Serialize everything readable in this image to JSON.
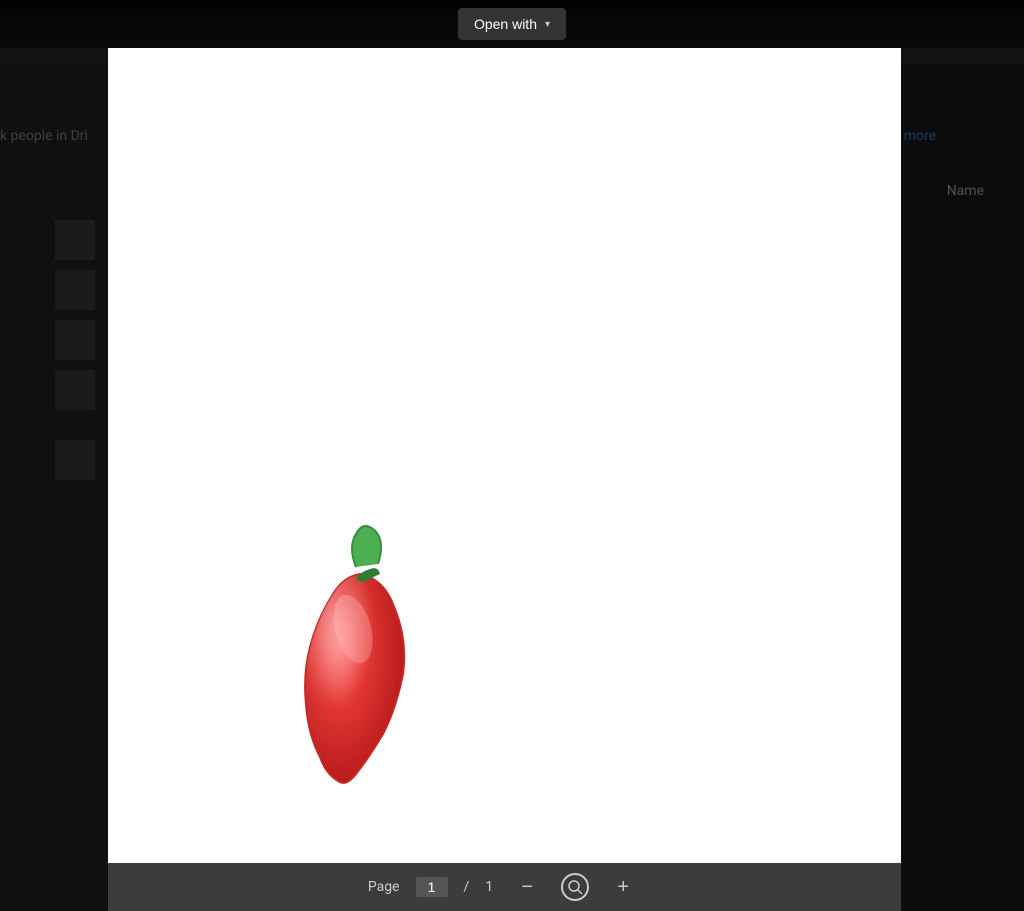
{
  "background": {
    "people_text": "k people in Dri",
    "more_text": "more",
    "name_col": "Name"
  },
  "modal": {
    "open_with_label": "Open with",
    "chevron": "▾"
  },
  "document": {
    "chili_emoji": "🌶️"
  },
  "toolbar": {
    "page_label": "Page",
    "current_page": "1",
    "separator": "/",
    "total_pages": "1",
    "zoom_out_icon": "−",
    "zoom_in_icon": "+"
  }
}
